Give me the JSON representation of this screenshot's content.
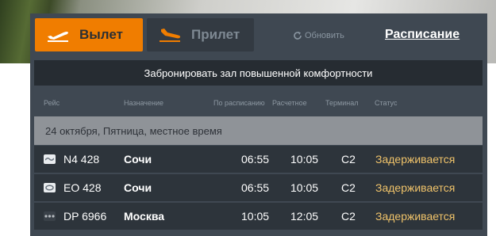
{
  "colors": {
    "accent": "#f07d00",
    "panel": "#3f4852",
    "row": "#2d343b",
    "status_delayed": "#f0c36a"
  },
  "tabs": {
    "departure": {
      "label": "Вылет",
      "icon": "plane-takeoff-icon",
      "active": true
    },
    "arrival": {
      "label": "Прилет",
      "icon": "plane-landing-icon",
      "active": false
    }
  },
  "refresh": {
    "label": "Обновить",
    "icon": "refresh-icon"
  },
  "schedule_link": "Расписание",
  "banner": "Забронировать зал повышенной комфортности",
  "columns": [
    "Рейс",
    "Назначение",
    "По расписанию",
    "Расчетное",
    "Терминал",
    "Статус"
  ],
  "date_line": "24 октября, Пятница, местное время",
  "flights": [
    {
      "logo": "airline-logo-wave-icon",
      "flight": "N4 428",
      "destination": "Сочи",
      "scheduled": "06:55",
      "estimated": "10:05",
      "terminal": "C2",
      "status": "Задерживается"
    },
    {
      "logo": "airline-logo-oval-icon",
      "flight": "EO 428",
      "destination": "Сочи",
      "scheduled": "06:55",
      "estimated": "10:05",
      "terminal": "C2",
      "status": "Задерживается"
    },
    {
      "logo": "airline-logo-dots-icon",
      "flight": "DP 6966",
      "destination": "Москва",
      "scheduled": "10:05",
      "estimated": "12:05",
      "terminal": "C2",
      "status": "Задерживается"
    }
  ]
}
